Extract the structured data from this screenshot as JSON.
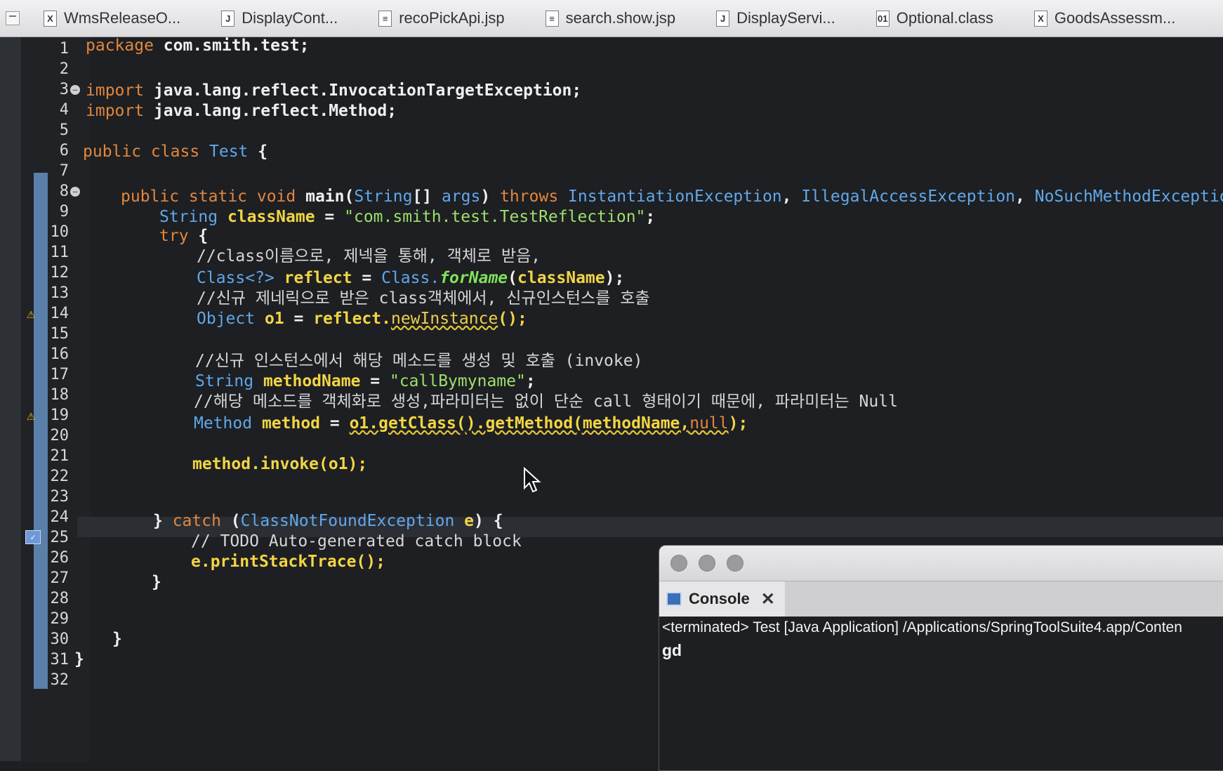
{
  "tabs": [
    {
      "label": "WmsReleaseO...",
      "icon": "xml-file-icon",
      "glyph": "X"
    },
    {
      "label": "DisplayCont...",
      "icon": "java-file-icon",
      "glyph": "J"
    },
    {
      "label": "recoPickApi.jsp",
      "icon": "jsp-file-icon",
      "glyph": "≡"
    },
    {
      "label": "search.show.jsp",
      "icon": "jsp-file-icon",
      "glyph": "≡"
    },
    {
      "label": "DisplayServi...",
      "icon": "java-file-icon",
      "glyph": "J"
    },
    {
      "label": "Optional.class",
      "icon": "class-file-icon",
      "glyph": "01"
    },
    {
      "label": "GoodsAssessm...",
      "icon": "xml-file-icon",
      "glyph": "X"
    }
  ],
  "line_numbers": [
    "1",
    "2",
    "3",
    "4",
    "5",
    "6",
    "7",
    "8",
    "9",
    "10",
    "11",
    "12",
    "13",
    "14",
    "15",
    "16",
    "17",
    "18",
    "19",
    "20",
    "21",
    "22",
    "23",
    "24",
    "25",
    "26",
    "27",
    "28",
    "29",
    "30",
    "31",
    "32"
  ],
  "code": {
    "l1": [
      "package",
      " com.smith.test;"
    ],
    "l3": [
      "import",
      " java.lang.reflect.InvocationTargetException;"
    ],
    "l4": [
      "import",
      " java.lang.reflect.Method;"
    ],
    "l6": [
      "public class",
      " Test",
      " {"
    ],
    "l8": [
      "public static void",
      " main(",
      "String",
      "[] ",
      "args",
      ") ",
      "throws",
      " InstantiationException",
      ", ",
      "IllegalAccessException",
      ", ",
      "NoSuchMethodException"
    ],
    "l9": [
      "String",
      " className",
      " = ",
      "\"com.smith.test.TestReflection\"",
      ";"
    ],
    "l10": [
      "try",
      " {"
    ],
    "l11": "//class이름으로, 제넥을 통해, 객체로 받음,",
    "l12": [
      "Class<?>",
      " reflect",
      " = ",
      "Class.",
      "forName",
      "(",
      "className",
      ");"
    ],
    "l13": "//신규 제네릭으로 받은 class객체에서, 신규인스턴스를 호출",
    "l14": [
      "Object",
      " o1",
      " = ",
      "reflect.",
      "newInstance",
      "();"
    ],
    "l16": "//신규 인스턴스에서 해당 메소드를 생성 및 호출 (invoke)",
    "l17": [
      "String",
      " methodName",
      " = ",
      "\"callBymyname\"",
      ";"
    ],
    "l18": "//해당 메소드를 객체화로 생성,파라미터는 없이 단순 call 형태이기 때문에, 파라미터는 Null",
    "l19": [
      "Method",
      " method",
      " = ",
      "o1.getClass().getMethod(methodName,",
      "null",
      ");"
    ],
    "l21": [
      "method.invoke(o1);"
    ],
    "l24": [
      "}",
      " catch",
      " (",
      "ClassNotFoundException",
      " e",
      ") {"
    ],
    "l25": "// TODO Auto-generated catch block",
    "l26": [
      "e",
      ".printStackTrace();"
    ],
    "l27": "}",
    "l30": "}",
    "l31": "}"
  },
  "console": {
    "tab_label": "Console",
    "status": "<terminated> Test [Java Application] /Applications/SpringToolSuite4.app/Conten",
    "output": "gd"
  },
  "colors": {
    "keyword": "#e2873e",
    "type": "#62a7ea",
    "string": "#9ee06a",
    "variable": "#f2d544",
    "background": "#1d1f22"
  }
}
